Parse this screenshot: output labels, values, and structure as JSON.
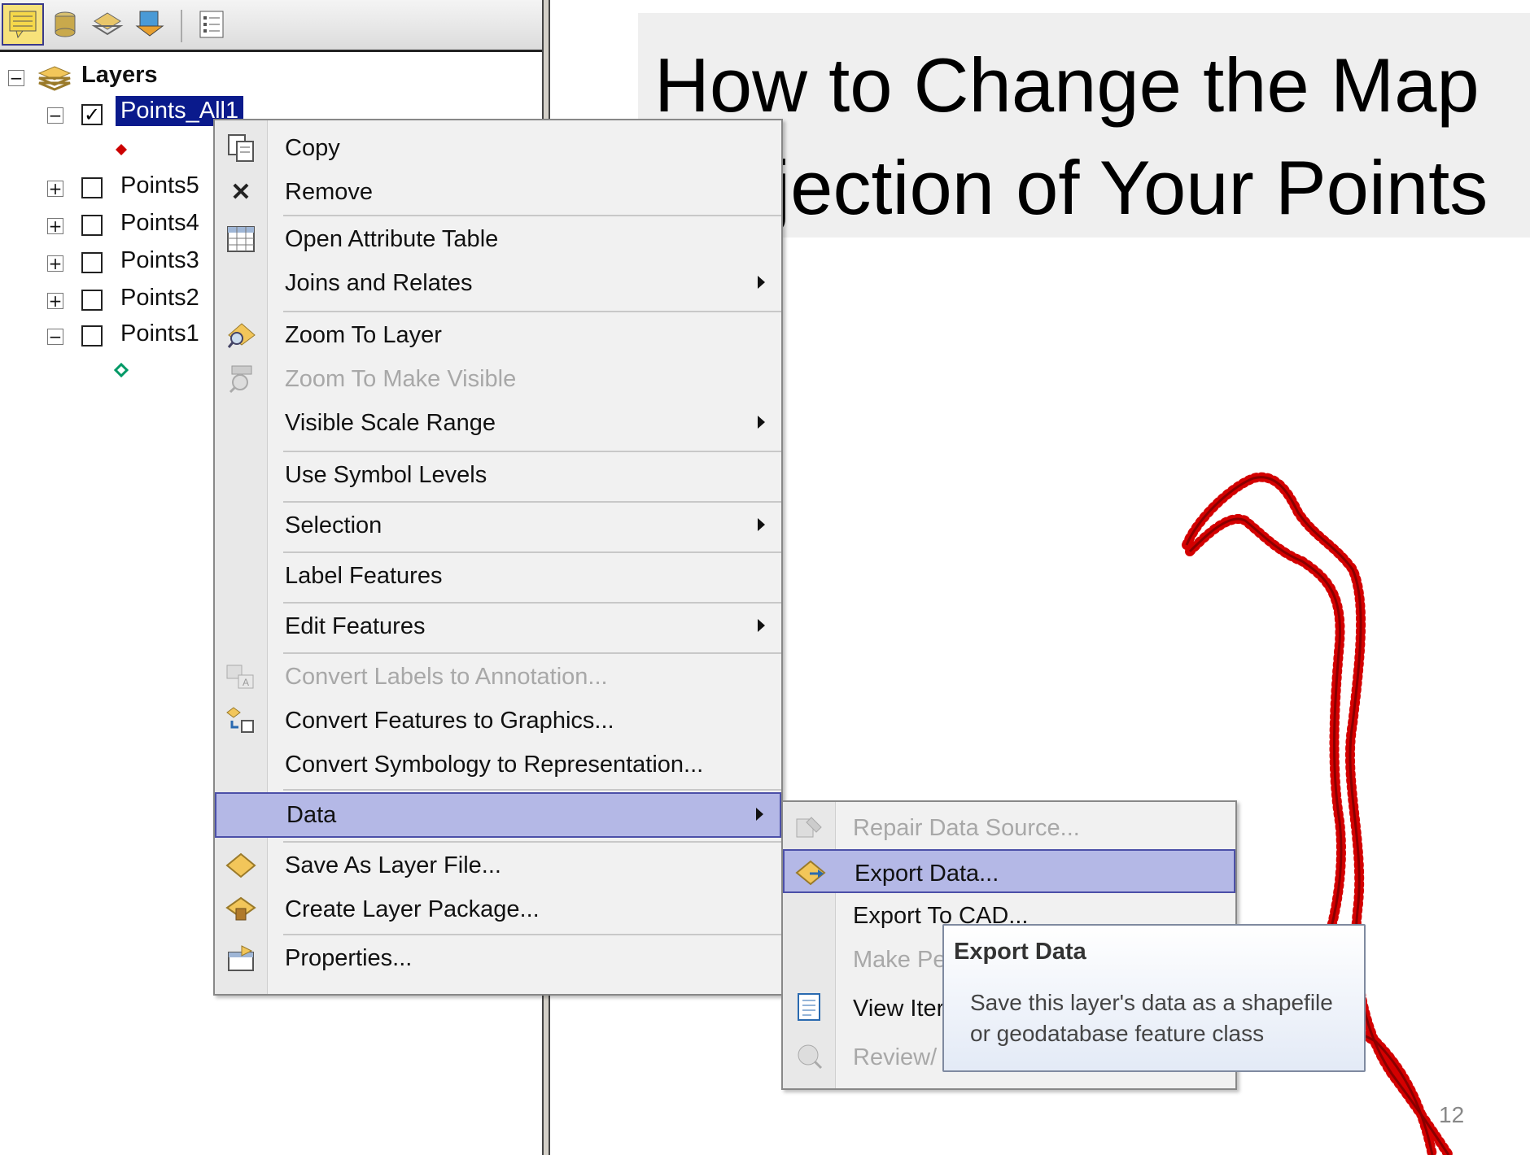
{
  "slide": {
    "title_line1": "How to Change the Map",
    "title_line2": "Projection of Your Points",
    "page_number": "12"
  },
  "toc": {
    "root_label": "Layers",
    "selected_layer": "Points_All1",
    "layers": [
      {
        "label": "Points5",
        "expanded": false,
        "checked": false
      },
      {
        "label": "Points4",
        "expanded": false,
        "checked": false
      },
      {
        "label": "Points3",
        "expanded": false,
        "checked": false
      },
      {
        "label": "Points2",
        "expanded": false,
        "checked": false
      },
      {
        "label": "Points1",
        "expanded": true,
        "checked": false
      }
    ]
  },
  "context_menu": {
    "items": [
      {
        "label": "Copy",
        "icon": "copy-icon",
        "enabled": true
      },
      {
        "label": "Remove",
        "icon": "remove-icon",
        "enabled": true
      },
      {
        "label": "Open Attribute Table",
        "icon": "table-icon",
        "enabled": true
      },
      {
        "label": "Joins and Relates",
        "icon": "",
        "enabled": true,
        "submenu": true
      },
      {
        "label": "Zoom To Layer",
        "icon": "zoom-to-layer-icon",
        "enabled": true
      },
      {
        "label": "Zoom To Make Visible",
        "icon": "zoom-visible-icon",
        "enabled": false
      },
      {
        "label": "Visible Scale Range",
        "icon": "",
        "enabled": true,
        "submenu": true
      },
      {
        "label": "Use Symbol Levels",
        "icon": "",
        "enabled": true
      },
      {
        "label": "Selection",
        "icon": "",
        "enabled": true,
        "submenu": true
      },
      {
        "label": "Label Features",
        "icon": "",
        "enabled": true
      },
      {
        "label": "Edit Features",
        "icon": "",
        "enabled": true,
        "submenu": true
      },
      {
        "label": "Convert Labels to Annotation...",
        "icon": "convert-labels-icon",
        "enabled": false
      },
      {
        "label": "Convert Features to Graphics...",
        "icon": "convert-features-icon",
        "enabled": true
      },
      {
        "label": "Convert Symbology to Representation...",
        "icon": "",
        "enabled": true
      },
      {
        "label": "Data",
        "icon": "",
        "enabled": true,
        "submenu": true,
        "highlighted": true
      },
      {
        "label": "Save As Layer File...",
        "icon": "save-layer-icon",
        "enabled": true
      },
      {
        "label": "Create Layer Package...",
        "icon": "layer-package-icon",
        "enabled": true
      },
      {
        "label": "Properties...",
        "icon": "properties-icon",
        "enabled": true
      }
    ]
  },
  "data_submenu": {
    "items": [
      {
        "label": "Repair Data Source...",
        "icon": "repair-icon",
        "enabled": false
      },
      {
        "label": "Export Data...",
        "icon": "export-data-icon",
        "enabled": true,
        "highlighted": true
      },
      {
        "label": "Export To CAD...",
        "icon": "",
        "enabled": true
      },
      {
        "label": "Make Pe",
        "icon": "",
        "enabled": false
      },
      {
        "label": "View Iter",
        "icon": "view-item-icon",
        "enabled": true
      },
      {
        "label": "Review/",
        "icon": "review-icon",
        "enabled": false
      }
    ]
  },
  "tooltip": {
    "title": "Export Data",
    "body": "Save this layer's data as a shapefile or geodatabase feature class"
  },
  "colors": {
    "highlight": "#b4b8e6",
    "highlight_border": "#4b4fa8",
    "selected_layer_bg": "#0a1a8c",
    "point_symbol_all": "#cc0000",
    "point_symbol_1": "#009966",
    "track": "#d40000"
  }
}
